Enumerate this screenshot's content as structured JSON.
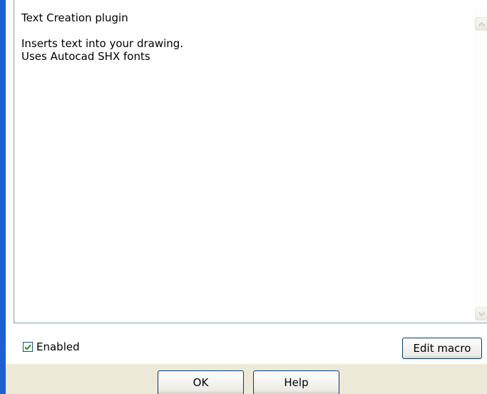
{
  "description": {
    "title": "Text Creation plugin",
    "line1": "Inserts text into your drawing.",
    "line2": "Uses Autocad SHX fonts"
  },
  "enabled": {
    "label": "Enabled",
    "checked": true
  },
  "buttons": {
    "edit_macro": "Edit macro",
    "ok": "OK",
    "help": "Help"
  },
  "icons": {
    "scroll_up": "chevron-up-icon",
    "scroll_down": "chevron-down-icon",
    "check": "checkmark-icon"
  },
  "colors": {
    "accent_border": "#1e5fd0",
    "dialog_bg": "#ece9d8",
    "check_green": "#21a121"
  }
}
